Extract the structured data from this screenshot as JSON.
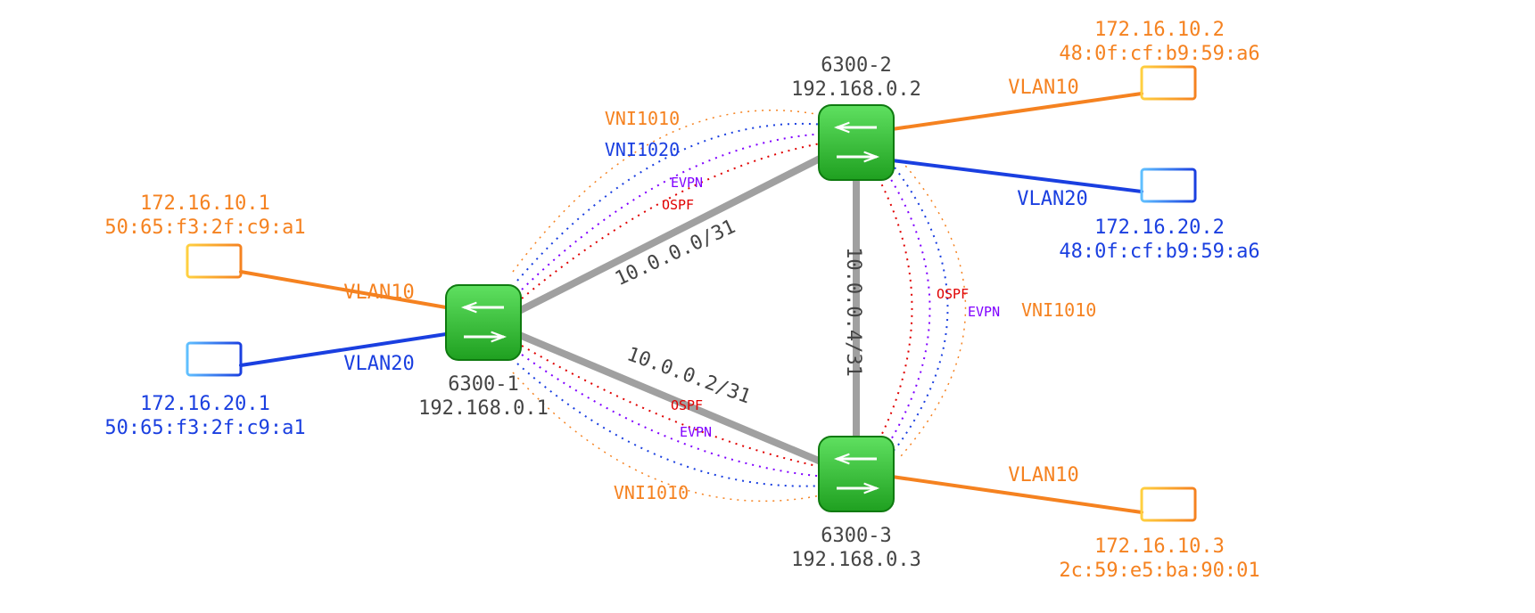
{
  "switches": {
    "s1": {
      "name": "6300-1",
      "loopback": "192.168.0.1"
    },
    "s2": {
      "name": "6300-2",
      "loopback": "192.168.0.2"
    },
    "s3": {
      "name": "6300-3",
      "loopback": "192.168.0.3"
    }
  },
  "core_links": {
    "s1_s2": "10.0.0.0/31",
    "s1_s3": "10.0.0.2/31",
    "s2_s3": "10.0.0.4/31"
  },
  "protocols": {
    "ospf": "OSPF",
    "evpn": "EVPN"
  },
  "vni": {
    "vni1010": "VNI1010",
    "vni1020": "VNI1020"
  },
  "vlans": {
    "vlan10": "VLAN10",
    "vlan20": "VLAN20"
  },
  "hosts": {
    "h1_v10": {
      "ip": "172.16.10.1",
      "mac": "50:65:f3:2f:c9:a1"
    },
    "h1_v20": {
      "ip": "172.16.20.1",
      "mac": "50:65:f3:2f:c9:a1"
    },
    "h2_v10": {
      "ip": "172.16.10.2",
      "mac": "48:0f:cf:b9:59:a6"
    },
    "h2_v20": {
      "ip": "172.16.20.2",
      "mac": "48:0f:cf:b9:59:a6"
    },
    "h3_v10": {
      "ip": "172.16.10.3",
      "mac": "2c:59:e5:ba:90:01"
    }
  },
  "colors": {
    "orange": "#f58220",
    "blue": "#1a3fe0",
    "red": "#e00000",
    "purple": "#8000ff",
    "grey": "#a0a0a0",
    "darkgrey": "#444444",
    "green_light": "#5fe060",
    "green_dark": "#1fa020"
  }
}
